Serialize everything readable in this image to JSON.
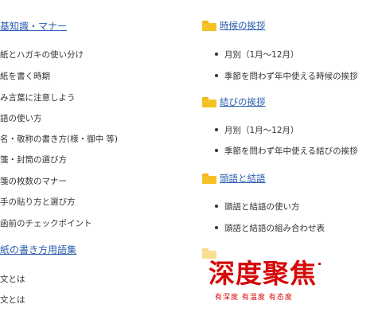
{
  "left": {
    "section1_title": "基知識・マナー",
    "items": [
      "紙とハガキの使い分け",
      "紙を書く時期",
      "み言葉に注意しよう",
      "語の使い方",
      "名・敬称の書き方(様・御中 等)",
      "箋・封筒の選び方",
      "箋の枚数のマナー",
      "手の貼り方と選び方",
      "函前のチェックポイント"
    ],
    "section2_title": "紙の書き方用語集",
    "items2": [
      "文とは",
      "文とは"
    ]
  },
  "right": {
    "sections": [
      {
        "title": "時候の挨拶",
        "items": [
          "月別（1月〜12月）",
          "季節を問わず年中使える時候の挨拶"
        ]
      },
      {
        "title": "結びの挨拶",
        "items": [
          "月別（1月〜12月）",
          "季節を問わず年中使える結びの挨拶"
        ]
      },
      {
        "title": "頭語と結語",
        "items": [
          "頭語と結語の使い方",
          "頭語と結語の組み合わせ表"
        ]
      }
    ]
  },
  "watermark": {
    "title": "深度聚焦",
    "subtitle": "有深度 有温度 有态度"
  },
  "colors": {
    "link": "#2a5db0",
    "text": "#333333",
    "folder": "#f5c226",
    "watermark": "#d40a0a"
  }
}
